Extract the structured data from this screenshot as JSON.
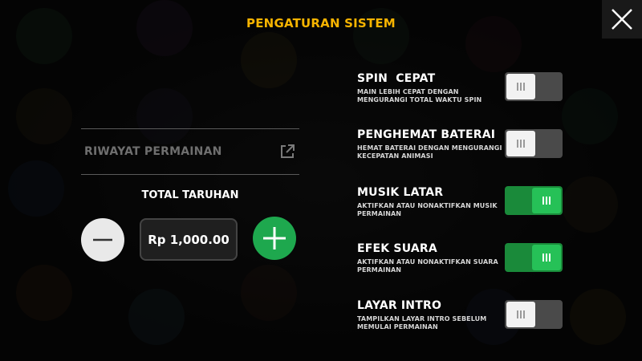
{
  "title": "PENGATURAN SISTEM",
  "history": {
    "label": "RIWAYAT PERMAINAN"
  },
  "bet": {
    "title": "TOTAL TARUHAN",
    "amount": "Rp 1,000.00"
  },
  "settings": [
    {
      "name": "SPIN  CEPAT",
      "desc": "MAIN LEBIH CEPAT DENGAN MENGURANGI TOTAL WAKTU SPIN",
      "enabled": false
    },
    {
      "name": "PENGHEMAT BATERAI",
      "desc": "HEMAT BATERAI DENGAN MENGURANGI KECEPATAN ANIMASI",
      "enabled": false
    },
    {
      "name": "MUSIK LATAR",
      "desc": "AKTIFKAN ATAU NONAKTIFKAN MUSIK PERMAINAN",
      "enabled": true
    },
    {
      "name": "EFEK SUARA",
      "desc": "AKTIFKAN ATAU NONAKTIFKAN SUARA PERMAINAN",
      "enabled": true
    },
    {
      "name": "LAYAR INTRO",
      "desc": "TAMPILKAN LAYAR INTRO SEBELUM MEMULAI PERMAINAN",
      "enabled": false
    }
  ],
  "colors": {
    "title": "#f7b400",
    "toggle_on": "#26c157",
    "plus_button": "#1ea84e"
  },
  "icons": {
    "close": "close-icon",
    "external": "external-link-icon",
    "minus": "minus-icon",
    "plus": "plus-icon"
  }
}
